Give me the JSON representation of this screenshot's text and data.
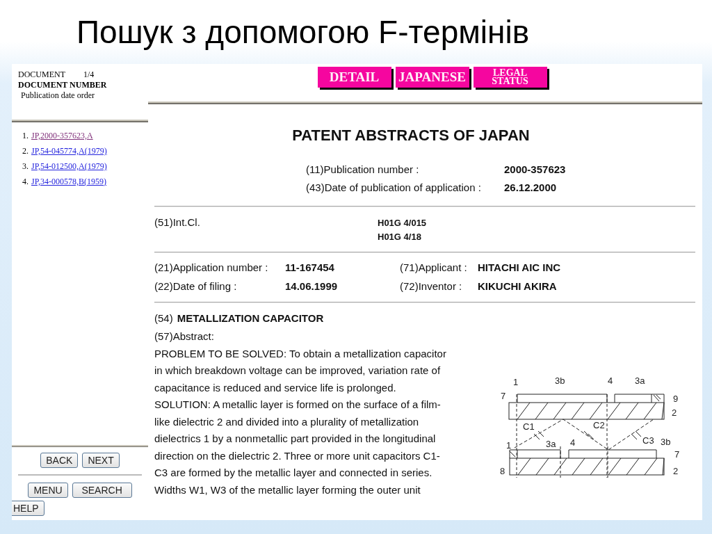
{
  "slide_title": "Пошук з допомогою F-термінів",
  "sidebar": {
    "document_label": "DOCUMENT",
    "document_count": "1/4",
    "sort_label": "DOCUMENT NUMBER",
    "sort_order": "Publication date order",
    "results": [
      {
        "number": "1.",
        "link": "JP,2000-357623,A",
        "visited": true
      },
      {
        "number": "2.",
        "link": "JP,54-045774,A(1979)",
        "visited": false
      },
      {
        "number": "3.",
        "link": "JP,54-012500,A(1979)",
        "visited": false
      },
      {
        "number": "4.",
        "link": "JP,34-000578,B(1959)",
        "visited": false
      }
    ],
    "nav_buttons": [
      "BACK",
      "NEXT"
    ],
    "menu_buttons": [
      "MENU",
      "SEARCH",
      "HELP"
    ]
  },
  "view_tabs": [
    {
      "label": "DETAIL",
      "kind": "single"
    },
    {
      "label": "JAPANESE",
      "kind": "single"
    },
    {
      "label": "LEGAL\nSTATUS",
      "kind": "double"
    }
  ],
  "document": {
    "heading": "PATENT ABSTRACTS OF JAPAN",
    "publication": [
      {
        "label": "(11)Publication number :",
        "value": "2000-357623"
      },
      {
        "label": "(43)Date of publication of application :",
        "value": "26.12.2000"
      }
    ],
    "int_cl": {
      "label": "(51)Int.Cl.",
      "values": [
        "H01G  4/015",
        "H01G  4/18"
      ]
    },
    "application_rows": [
      [
        {
          "label": "(21)Application number :",
          "value": "11-167454"
        },
        {
          "label": "(71)Applicant :",
          "value": "HITACHI AIC INC"
        }
      ],
      [
        {
          "label": "(22)Date of filing :",
          "value": "14.06.1999"
        },
        {
          "label": "(72)Inventor :",
          "value": "KIKUCHI AKIRA"
        }
      ]
    ],
    "title": {
      "number": "(54)",
      "text": "METALLIZATION CAPACITOR"
    },
    "abstract_label": "(57)Abstract:",
    "abstract_paragraphs": [
      [
        "PROBLEM TO BE SOLVED: To obtain a metallization capacitor",
        "in which breakdown voltage can be improved, variation rate of",
        "capacitance is reduced and service life is prolonged."
      ],
      [
        "SOLUTION: A metallic layer is formed on the surface of a film-",
        "like dielectric 2 and divided into a plurality of metallization",
        "dielectrics 1 by a nonmetallic part provided in the longitudinal",
        "direction on the dielectric 2. Three or more unit capacitors C1-",
        "C3 are formed by the metallic layer and connected in series.",
        "Widths W1, W3 of the metallic layer forming the outer unit"
      ]
    ],
    "figure_labels": [
      "1",
      "3b",
      "4",
      "3a",
      "7",
      "9",
      "2",
      "C1",
      "C2",
      "C3",
      "1",
      "3a",
      "4",
      "3b",
      "7",
      "8",
      "2"
    ]
  }
}
